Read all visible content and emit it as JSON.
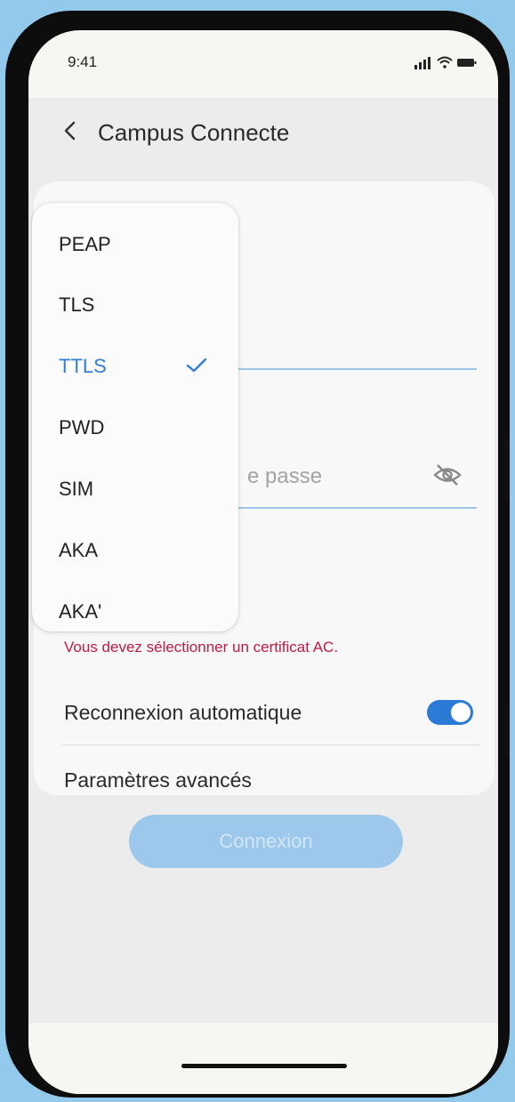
{
  "status_bar": {
    "time": "9:41",
    "icons": [
      "signal-icon",
      "wifi-icon",
      "battery-icon"
    ]
  },
  "header": {
    "title": "Campus Connecte",
    "back_icon": "chevron-left-icon"
  },
  "form": {
    "password_placeholder_partial": "e passe",
    "password_visibility_icon": "eye-slash-icon",
    "error_message": "Vous devez sélectionner un certificat AC.",
    "auto_reconnect_label": "Reconnexion automatique",
    "auto_reconnect_enabled": true,
    "advanced_settings_label": "Paramètres avancés"
  },
  "connect_button": {
    "label": "Connexion",
    "enabled": false
  },
  "eap_dropdown": {
    "selected": "TTLS",
    "options": [
      {
        "label": "PEAP",
        "selected": false
      },
      {
        "label": "TLS",
        "selected": false
      },
      {
        "label": "TTLS",
        "selected": true
      },
      {
        "label": "PWD",
        "selected": false
      },
      {
        "label": "SIM",
        "selected": false
      },
      {
        "label": "AKA",
        "selected": false
      },
      {
        "label": "AKA'",
        "selected": false
      }
    ]
  },
  "colors": {
    "background": "#93c9ea",
    "accent": "#2f7fd6",
    "toggle_on": "#2b7ad6",
    "error": "#c01a43",
    "disabled_button": "#9cc8ec"
  }
}
